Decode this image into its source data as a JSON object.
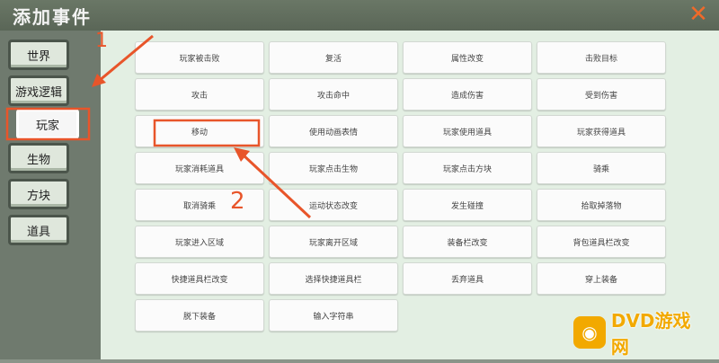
{
  "window": {
    "title": "添加事件",
    "close_icon": "close-x-icon",
    "close_color": "#f06a2a"
  },
  "sidebar": {
    "items": [
      {
        "label": "世界"
      },
      {
        "label": "游戏逻辑"
      },
      {
        "label": "玩家",
        "active": true
      },
      {
        "label": "生物"
      },
      {
        "label": "方块"
      },
      {
        "label": "道具"
      }
    ]
  },
  "events": [
    "玩家被击败",
    "复活",
    "属性改变",
    "击败目标",
    "攻击",
    "攻击命中",
    "造成伤害",
    "受到伤害",
    "移动",
    "使用动画表情",
    "玩家使用道具",
    "玩家获得道具",
    "玩家消耗道具",
    "玩家点击生物",
    "玩家点击方块",
    "骑乘",
    "取消骑乘",
    "运动状态改变",
    "发生碰撞",
    "拾取掉落物",
    "玩家进入区域",
    "玩家离开区域",
    "装备栏改变",
    "背包道具栏改变",
    "快捷道具栏改变",
    "选择快捷道具栏",
    "丢弃道具",
    "穿上装备",
    "脱下装备",
    "输入字符串"
  ],
  "annotations": {
    "label_1": "1",
    "label_2": "2",
    "color": "#e8552a"
  },
  "watermark": {
    "text": "DVD游戏网"
  }
}
